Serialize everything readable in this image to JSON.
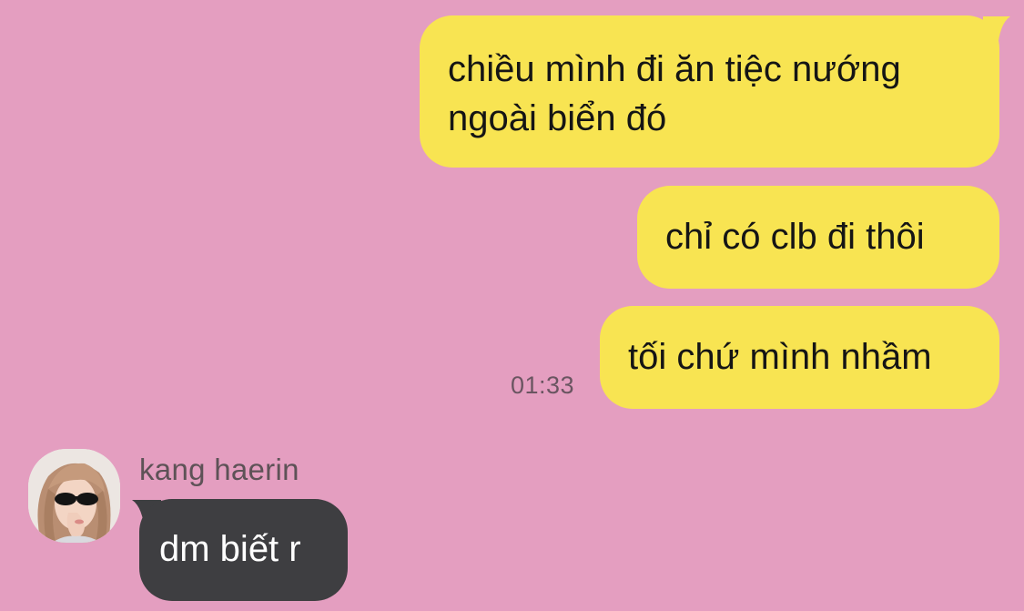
{
  "chat": {
    "outgoing": [
      {
        "text": "chiều mình đi ăn tiệc nướng\nngoài biển đó"
      },
      {
        "text": "chỉ có clb đi thôi"
      },
      {
        "text": "tối chứ mình nhầm"
      }
    ],
    "outgoing_timestamp": "01:33",
    "incoming": {
      "sender_name": "kang haerin",
      "avatar_icon": "user-avatar-photo",
      "messages": [
        {
          "text": "dm biết r"
        }
      ]
    }
  },
  "colors": {
    "background": "#e49ec0",
    "outgoing_bubble": "#f8e452",
    "incoming_bubble": "#3e3e41",
    "incoming_text": "#ffffff",
    "outgoing_text": "#151515"
  }
}
